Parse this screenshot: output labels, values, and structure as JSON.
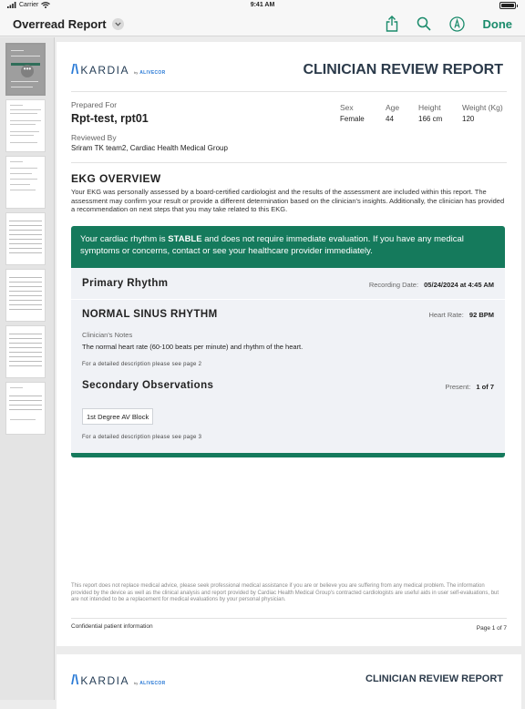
{
  "status_bar": {
    "carrier": "Carrier",
    "time": "9:41 AM"
  },
  "nav": {
    "title": "Overread Report",
    "done_label": "Done"
  },
  "colors": {
    "accent": "#1a8b6b",
    "banner": "#157a5c",
    "title": "#2b3a4a",
    "logo_blue": "#2a7ad6"
  },
  "report": {
    "logo_text": "KARDIA",
    "logo_by": "by",
    "logo_brand": "ALIVECOR",
    "title": "CLINICIAN REVIEW REPORT",
    "prepared_for_label": "Prepared For",
    "patient_name": "Rpt-test, rpt01",
    "reviewed_by_label": "Reviewed By",
    "reviewer": "Sriram TK team2, Cardiac Health Medical Group",
    "demographics": [
      {
        "label": "Sex",
        "value": "Female"
      },
      {
        "label": "Age",
        "value": "44"
      },
      {
        "label": "Height",
        "value": "166 cm"
      },
      {
        "label": "Weight (Kg)",
        "value": "120"
      }
    ],
    "ekg_heading": "EKG OVERVIEW",
    "intro": "Your EKG was personally assessed by a board-certified cardiologist and the results of the assessment are included within this report. The assessment may confirm your result or provide a different determination based on the clinician's insights. Additionally, the clinician has provided a recommendation on next steps that you may take related to this EKG.",
    "banner_pre": "Your cardiac rhythm is ",
    "banner_bold": "STABLE",
    "banner_post": " and does not require immediate evaluation. If you have any medical symptoms or concerns, contact or see your healthcare provider immediately.",
    "primary_heading": "Primary Rhythm",
    "recording_label": "Recording Date:",
    "recording_value": "05/24/2024 at 4:45 AM",
    "rhythm": "NORMAL SINUS RHYTHM",
    "hr_label": "Heart Rate:",
    "hr_value": "92 BPM",
    "notes_label": "Clinician's Notes",
    "notes_text": "The normal heart rate (60-100 beats per minute) and rhythm of the heart.",
    "detail_page2": "For a detailed description please see page 2",
    "secondary_heading": "Secondary Observations",
    "present_label": "Present:",
    "present_value": "1 of 7",
    "observation_tag": "1st Degree AV Block",
    "detail_page3": "For a detailed description please see page 3",
    "disclaimer": "This report does not replace medical advice, please seek professional medical assistance if you are or believe you are suffering from any medical problem. The information provided by the device as well as the clinical analysis and report provided by Cardiac Health Medical Group's contracted cardiologists are useful aids in user self-evaluations, but are not intended to be a replacement for medical evaluations by your personal physician.",
    "confidential": "Confidential patient information",
    "page_label": "Page 1 of 7"
  },
  "page2_header": {
    "logo_text": "KARDIA",
    "logo_by": "by",
    "logo_brand": "ALIVECOR",
    "title": "CLINICIAN REVIEW REPORT"
  }
}
